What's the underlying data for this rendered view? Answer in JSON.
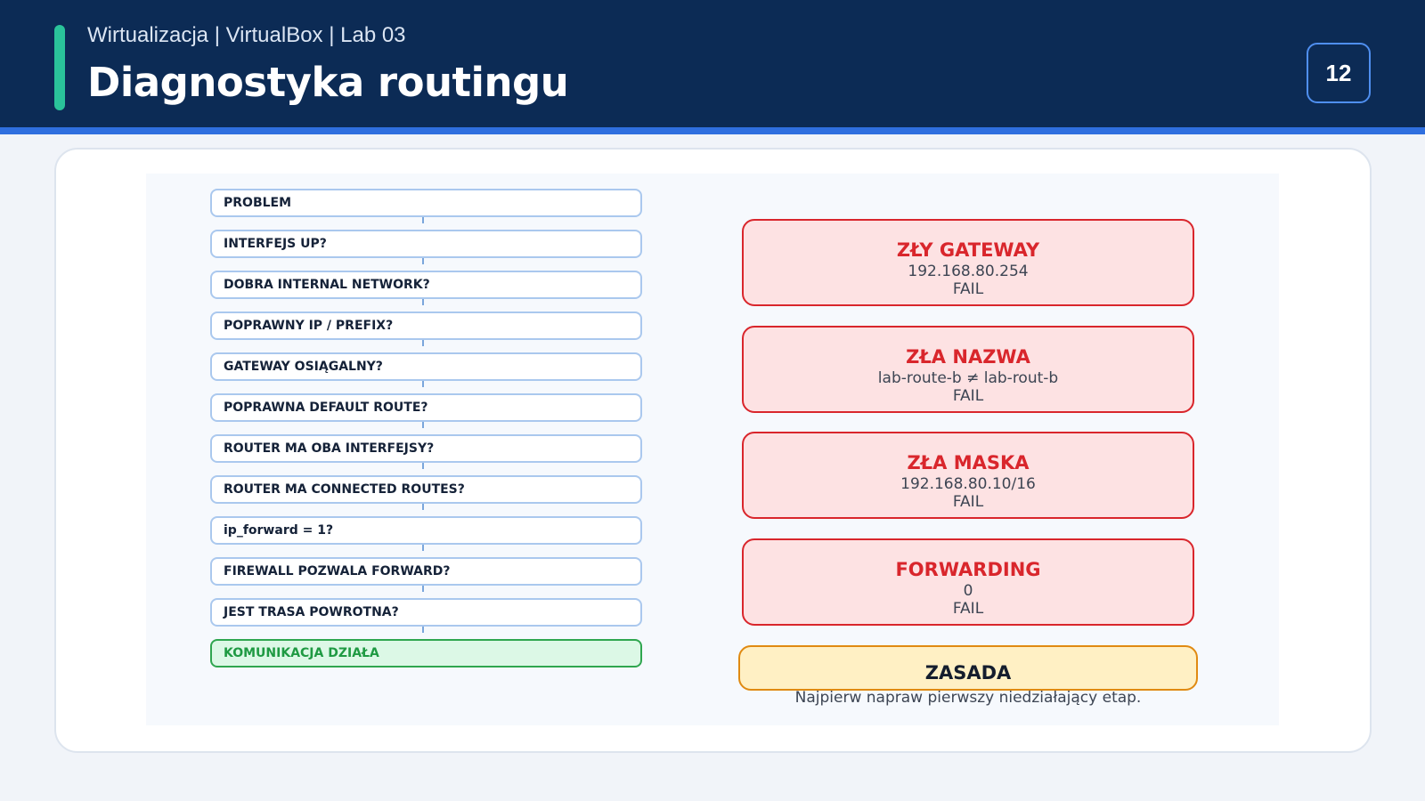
{
  "header": {
    "subtitle": "Wirtualizacja | VirtualBox | Lab 03",
    "title": "Diagnostyka routingu",
    "page_number": "12"
  },
  "flowchart": {
    "steps": [
      {
        "label": "PROBLEM"
      },
      {
        "label": "INTERFEJS UP?"
      },
      {
        "label": "DOBRA INTERNAL NETWORK?"
      },
      {
        "label": "POPRAWNY IP / PREFIX?"
      },
      {
        "label": "GATEWAY OSIĄGALNY?"
      },
      {
        "label": "POPRAWNA DEFAULT ROUTE?"
      },
      {
        "label": "ROUTER MA OBA INTERFEJSY?"
      },
      {
        "label": "ROUTER MA CONNECTED ROUTES?"
      },
      {
        "label": "ip_forward = 1?"
      },
      {
        "label": "FIREWALL POZWALA FORWARD?"
      },
      {
        "label": "JEST TRASA POWROTNA?"
      },
      {
        "label": "KOMUNIKACJA DZIAŁA"
      }
    ]
  },
  "failures": [
    {
      "title": "ZŁY GATEWAY",
      "detail": "192.168.80.254",
      "status": "FAIL"
    },
    {
      "title": "ZŁA NAZWA",
      "detail": "lab-route-b ≠ lab-rout-b",
      "status": "FAIL"
    },
    {
      "title": "ZŁA MASKA",
      "detail": "192.168.80.10/16",
      "status": "FAIL"
    },
    {
      "title": "FORWARDING",
      "detail": "0",
      "status": "FAIL"
    }
  ],
  "rule": {
    "title": "ZASADA",
    "text": "Najpierw napraw pierwszy niedziałający etap."
  },
  "colors": {
    "header_bg": "#0c2b55",
    "accent_teal": "#2ac39a",
    "accent_blue": "#2f6fdf",
    "fail_red": "#d9262c",
    "fail_bg": "#fde2e3",
    "ok_green": "#1f9a43",
    "ok_bg": "#dcf8e6",
    "rule_orange": "#e08a12",
    "rule_bg": "#fff0c4"
  }
}
